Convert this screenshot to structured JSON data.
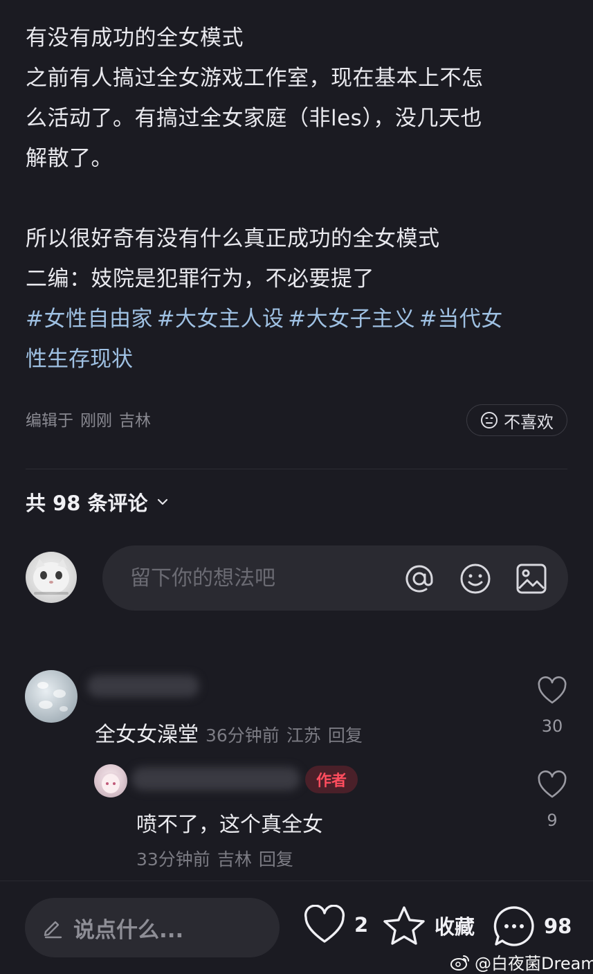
{
  "post": {
    "lines": [
      "有没有成功的全女模式",
      "之前有人搞过全女游戏工作室，现在基本上不怎",
      "么活动了。有搞过全女家庭（非les），没几天也",
      "解散了。",
      "",
      "所以很好奇有没有什么真正成功的全女模式",
      "二编：妓院是犯罪行为，不必要提了"
    ],
    "tags_line1": [
      "#女性自由家",
      "#大女主人设",
      "#大女子主义",
      "#当代女"
    ],
    "tags_line2": "性生存现状",
    "meta": {
      "edited": "编辑于",
      "time": "刚刚",
      "location": "吉林"
    },
    "dislike_label": "不喜欢"
  },
  "comments_header": {
    "label": "共 98 条评论"
  },
  "comment_input": {
    "placeholder": "留下你的想法吧"
  },
  "comments": [
    {
      "text": "全女女澡堂",
      "time": "36分钟前",
      "location": "江苏",
      "reply_label": "回复",
      "likes": "30"
    }
  ],
  "reply": {
    "badge": "作者",
    "text": "喷不了，这个真全女",
    "time": "33分钟前",
    "location": "吉林",
    "reply_label": "回复",
    "likes": "9"
  },
  "bottom_bar": {
    "say_placeholder": "说点什么...",
    "likes": "2",
    "collect_label": "收藏",
    "comments": "98"
  },
  "watermark": "@白夜菌Dream"
}
